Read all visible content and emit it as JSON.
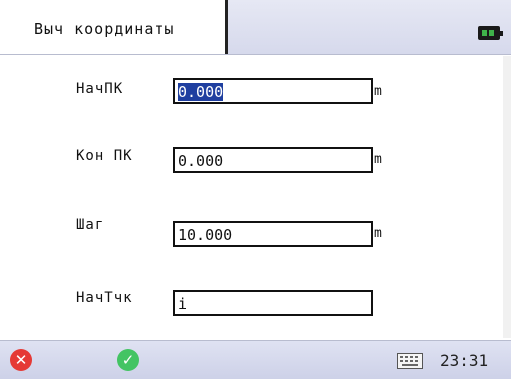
{
  "header": {
    "title": "Выч координаты"
  },
  "fields": [
    {
      "label": "НачПК",
      "value": "0.000",
      "unit": "m"
    },
    {
      "label": "Кон ПК",
      "value": "0.000",
      "unit": "m"
    },
    {
      "label": "Шаг",
      "value": "10.000",
      "unit": "m"
    },
    {
      "label": "НачТчк",
      "value": "i",
      "unit": ""
    }
  ],
  "footer": {
    "time": "23:31"
  },
  "icons": {
    "battery": "battery-icon",
    "cancel": "close-icon",
    "ok": "check-icon",
    "keyboard": "keyboard-icon"
  },
  "colors": {
    "cancel": "#e53935",
    "ok": "#43c463",
    "selection": "#1f3fa0",
    "battery": "#3fb34a"
  }
}
